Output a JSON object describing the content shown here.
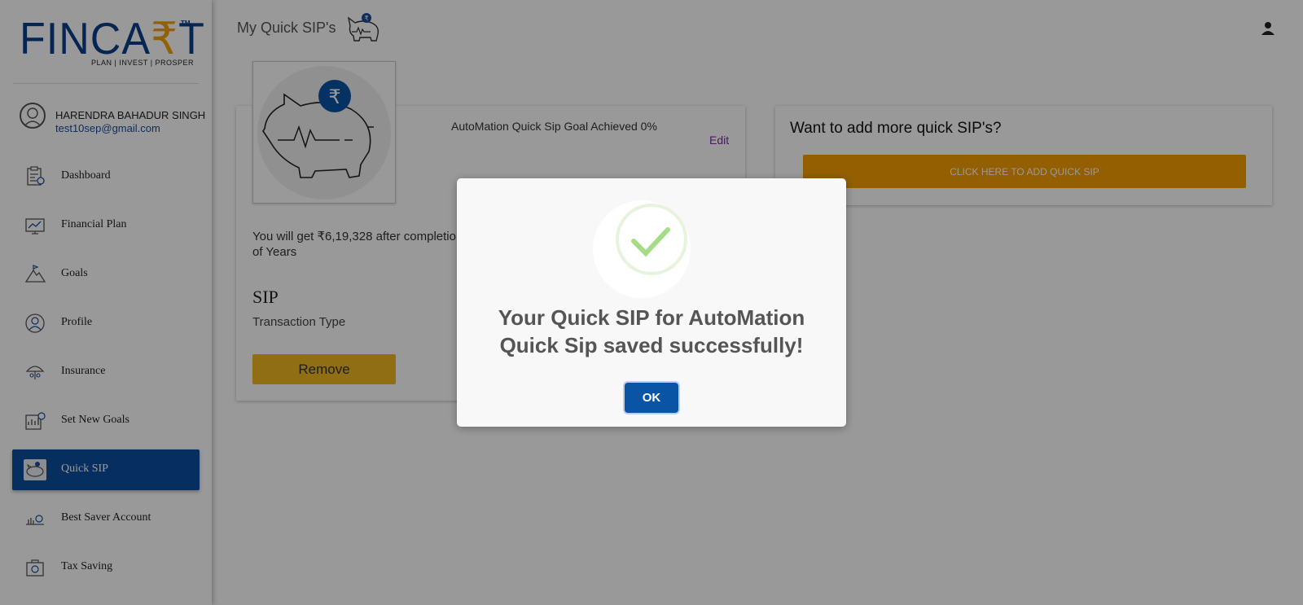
{
  "brand": {
    "logo_main": "FINCA",
    "logo_accent": "₹",
    "logo_end": "T",
    "tm": "TM",
    "tagline": "PLAN | INVEST | PROSPER"
  },
  "user": {
    "name": "HARENDRA BAHADUR SINGH",
    "email": "test10sep@gmail.com"
  },
  "nav": {
    "items": [
      {
        "label": "Dashboard",
        "icon": "dashboard-icon"
      },
      {
        "label": "Financial Plan",
        "icon": "financial-plan-icon"
      },
      {
        "label": "Goals",
        "icon": "goals-icon"
      },
      {
        "label": "Profile",
        "icon": "profile-icon"
      },
      {
        "label": "Insurance",
        "icon": "insurance-icon"
      },
      {
        "label": "Set New Goals",
        "icon": "set-goals-icon"
      },
      {
        "label": "Quick SIP",
        "icon": "quick-sip-icon",
        "active": true
      },
      {
        "label": "Best Saver Account",
        "icon": "saver-account-icon"
      },
      {
        "label": "Tax Saving",
        "icon": "tax-saving-icon"
      }
    ]
  },
  "header": {
    "title": "My Quick SIP's"
  },
  "sip_card": {
    "goal_text": "AutoMation Quick Sip Goal Achieved 0%",
    "edit_label": "Edit",
    "you_get_text": "You will get ₹6,19,328 after completion of Years",
    "type_value": "SIP",
    "type_label": "Transaction Type",
    "remove_label": "Remove"
  },
  "add_card": {
    "title": "Want to add more quick SIP's?",
    "button_label": "CLICK HERE TO ADD QUICK SIP"
  },
  "modal": {
    "message": "Your Quick SIP for AutoMation Quick Sip saved successfully!",
    "ok_label": "OK"
  },
  "colors": {
    "primary": "#0a4f9e",
    "accent": "#f59e00",
    "remove": "#f0b722",
    "success": "#a5dc86"
  }
}
